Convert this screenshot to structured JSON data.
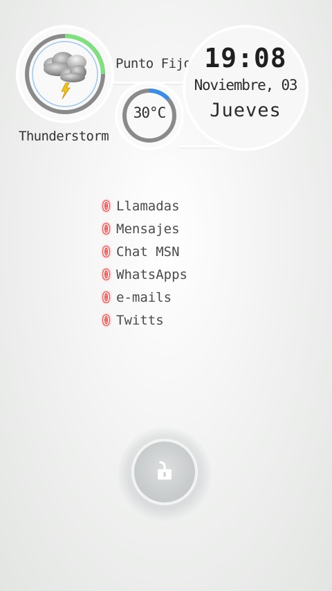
{
  "weather": {
    "city": "Punto Fijo",
    "condition": "Thunderstorm",
    "icon": "thunderstorm-icon",
    "temperature": "30°C",
    "ring_color": "#7fe07f",
    "temp_ring_color": "#3b8ce8"
  },
  "clock": {
    "time": "19:08",
    "date": "Noviembre, 03",
    "day": "Jueves"
  },
  "notifications": [
    {
      "count": "0",
      "label": "Llamadas"
    },
    {
      "count": "0",
      "label": "Mensajes"
    },
    {
      "count": "0",
      "label": "Chat MSN"
    },
    {
      "count": "0",
      "label": "WhatsApps"
    },
    {
      "count": "0",
      "label": "e-mails"
    },
    {
      "count": "0",
      "label": "Twitts"
    }
  ],
  "unlock": {
    "icon": "unlock-icon"
  },
  "colors": {
    "badge": "#ff3b3b",
    "text": "#4a4a4a"
  }
}
